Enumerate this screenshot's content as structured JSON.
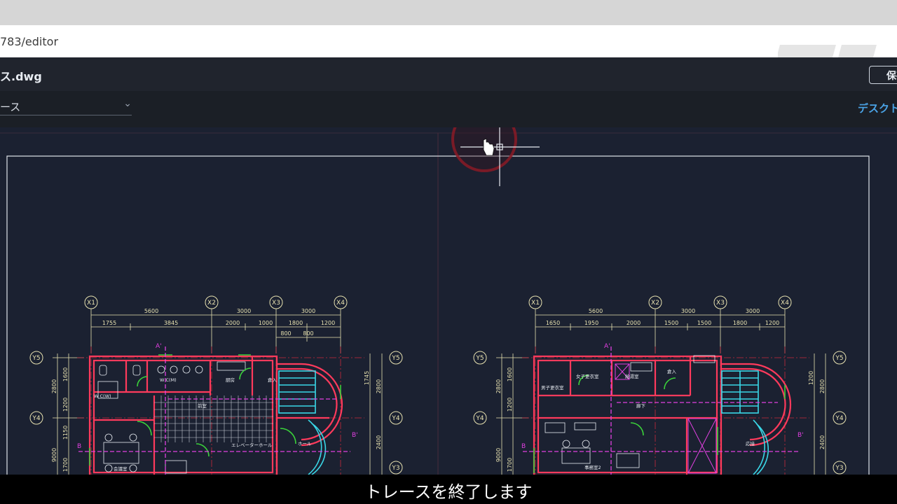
{
  "browser": {
    "address": "783/editor"
  },
  "app": {
    "file_title": "ス.dwg",
    "save_label": "保存"
  },
  "toolbar": {
    "mode_value": "トレース",
    "mode_visible": "ース",
    "desktop_link": "デスクトップ"
  },
  "drawing": {
    "grid_labels_x": [
      "X1",
      "X2",
      "X3",
      "X4"
    ],
    "grid_labels_y": [
      "Y5",
      "Y4",
      "Y3"
    ],
    "left_plan": {
      "top_dims": [
        "5600",
        "3000",
        "3000"
      ],
      "sub_dims": [
        "1755",
        "3845",
        "2000",
        "1000",
        "1800",
        "1200"
      ],
      "sub_dims_2": [
        "800",
        "800"
      ],
      "side_dims_left": [
        "2800",
        "1600",
        "1200",
        "1150",
        "9000",
        "1700"
      ],
      "side_dims_right": [
        "2800",
        "1745",
        "2400"
      ],
      "markers": [
        "A'",
        "B",
        "B'"
      ],
      "room_labels": [
        "W C(M)",
        "W C(W)",
        "厨房",
        "会議室",
        "エレベーターホール",
        "ホール",
        "前室",
        "倉入"
      ]
    },
    "right_plan": {
      "top_dims": [
        "5600",
        "3000",
        "3000"
      ],
      "sub_dims": [
        "1650",
        "1950",
        "2000",
        "1500",
        "1500",
        "1800",
        "1200"
      ],
      "side_dims_left": [
        "2800",
        "1600",
        "1200",
        "9000",
        "1700"
      ],
      "side_dims_right": [
        "2800",
        "1200",
        "2400"
      ],
      "markers": [
        "A'",
        "B",
        "B'"
      ],
      "room_labels": [
        "男子更衣室",
        "女子更衣室",
        "給湯室",
        "倉入",
        "廊下",
        "事務室2",
        "応接"
      ]
    }
  },
  "cursor": {
    "type": "hand-with-crosshair"
  },
  "subtitle": "トレースを終了します",
  "colors": {
    "canvas_bg": "#1b2131",
    "wall": "#ff3a5c",
    "dim": "#e8e2b0",
    "magenta": "#e040e0",
    "green": "#3ad13a",
    "cyan": "#3ad8e8",
    "accent_link": "#4aa3e6"
  }
}
